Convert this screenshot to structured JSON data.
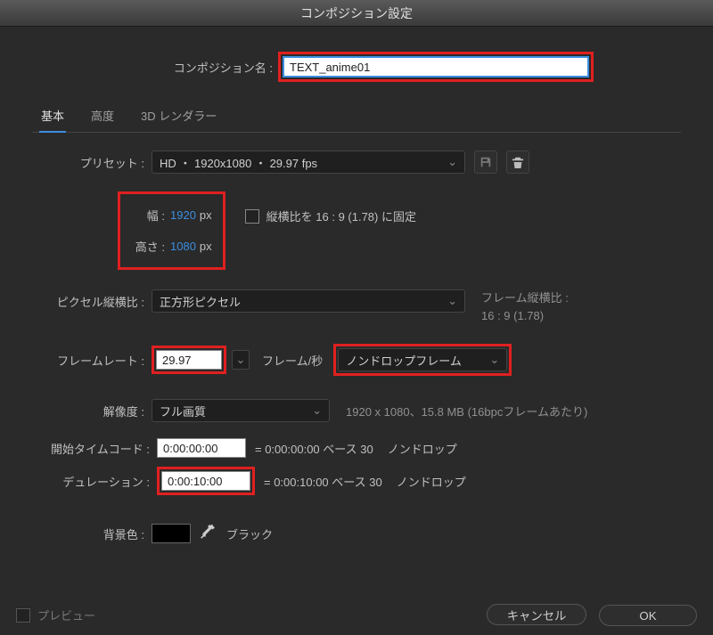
{
  "title": "コンポジション設定",
  "comp_name": {
    "label": "コンポジション名 :",
    "value": "TEXT_anime01"
  },
  "tabs": {
    "basic": "基本",
    "advanced": "高度",
    "renderer": "3D レンダラー"
  },
  "preset": {
    "label": "プリセット :",
    "value": "HD  ・ 1920x1080 ・ 29.97 fps"
  },
  "width": {
    "label": "幅 :",
    "value": "1920",
    "unit": "px"
  },
  "height": {
    "label": "高さ :",
    "value": "1080",
    "unit": "px"
  },
  "lock_ar": {
    "label": "縦横比を 16 : 9 (1.78) に固定"
  },
  "par": {
    "label": "ピクセル縦横比 :",
    "value": "正方形ピクセル",
    "info_label": "フレーム縦横比 :",
    "info_value": "16 : 9 (1.78)"
  },
  "framerate": {
    "label": "フレームレート :",
    "value": "29.97",
    "unit": "フレーム/秒",
    "drop": "ノンドロップフレーム"
  },
  "resolution": {
    "label": "解像度 :",
    "value": "フル画質",
    "info": "1920 x 1080、15.8 MB (16bpcフレームあたり)"
  },
  "start_tc": {
    "label": "開始タイムコード :",
    "value": "0:00:00:00",
    "info": "= 0:00:00:00  ベース 30",
    "drop": "ノンドロップ"
  },
  "duration": {
    "label": "デュレーション :",
    "value": "0:00:10:00",
    "info": "= 0:00:10:00  ベース 30",
    "drop": "ノンドロップ"
  },
  "bgcolor": {
    "label": "背景色 :",
    "name": "ブラック"
  },
  "footer": {
    "preview": "プレビュー",
    "cancel": "キャンセル",
    "ok": "OK"
  },
  "colors": {
    "accent": "#3d8ee0",
    "highlight": "#e02020"
  }
}
